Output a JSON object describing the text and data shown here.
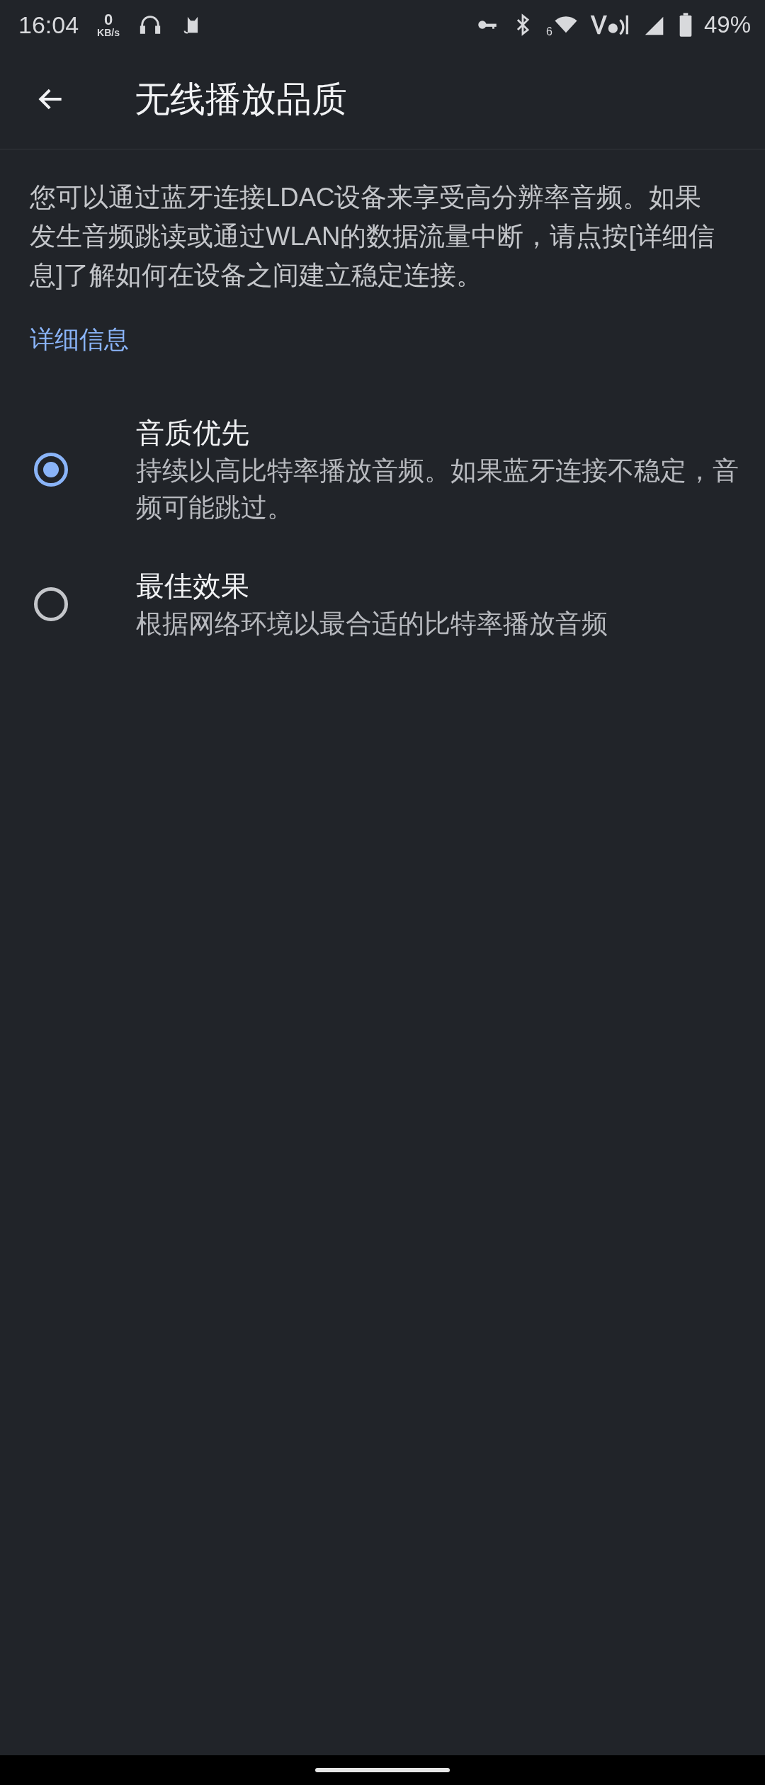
{
  "status_bar": {
    "time": "16:04",
    "net_speed": "0",
    "net_unit": "KB/s",
    "wifi_band": "6",
    "battery": "49%"
  },
  "app_bar": {
    "title": "无线播放品质"
  },
  "description": "您可以通过蓝牙连接LDAC设备来享受高分辨率音频。如果发生音频跳读或通过WLAN的数据流量中断，请点按[详细信息]了解如何在设备之间建立稳定连接。",
  "link": "详细信息",
  "options": [
    {
      "title": "音质优先",
      "summary": "持续以高比特率播放音频。如果蓝牙连接不稳定，音频可能跳过。",
      "selected": true
    },
    {
      "title": "最佳效果",
      "summary": "根据网络环境以最合适的比特率播放音频",
      "selected": false
    }
  ]
}
